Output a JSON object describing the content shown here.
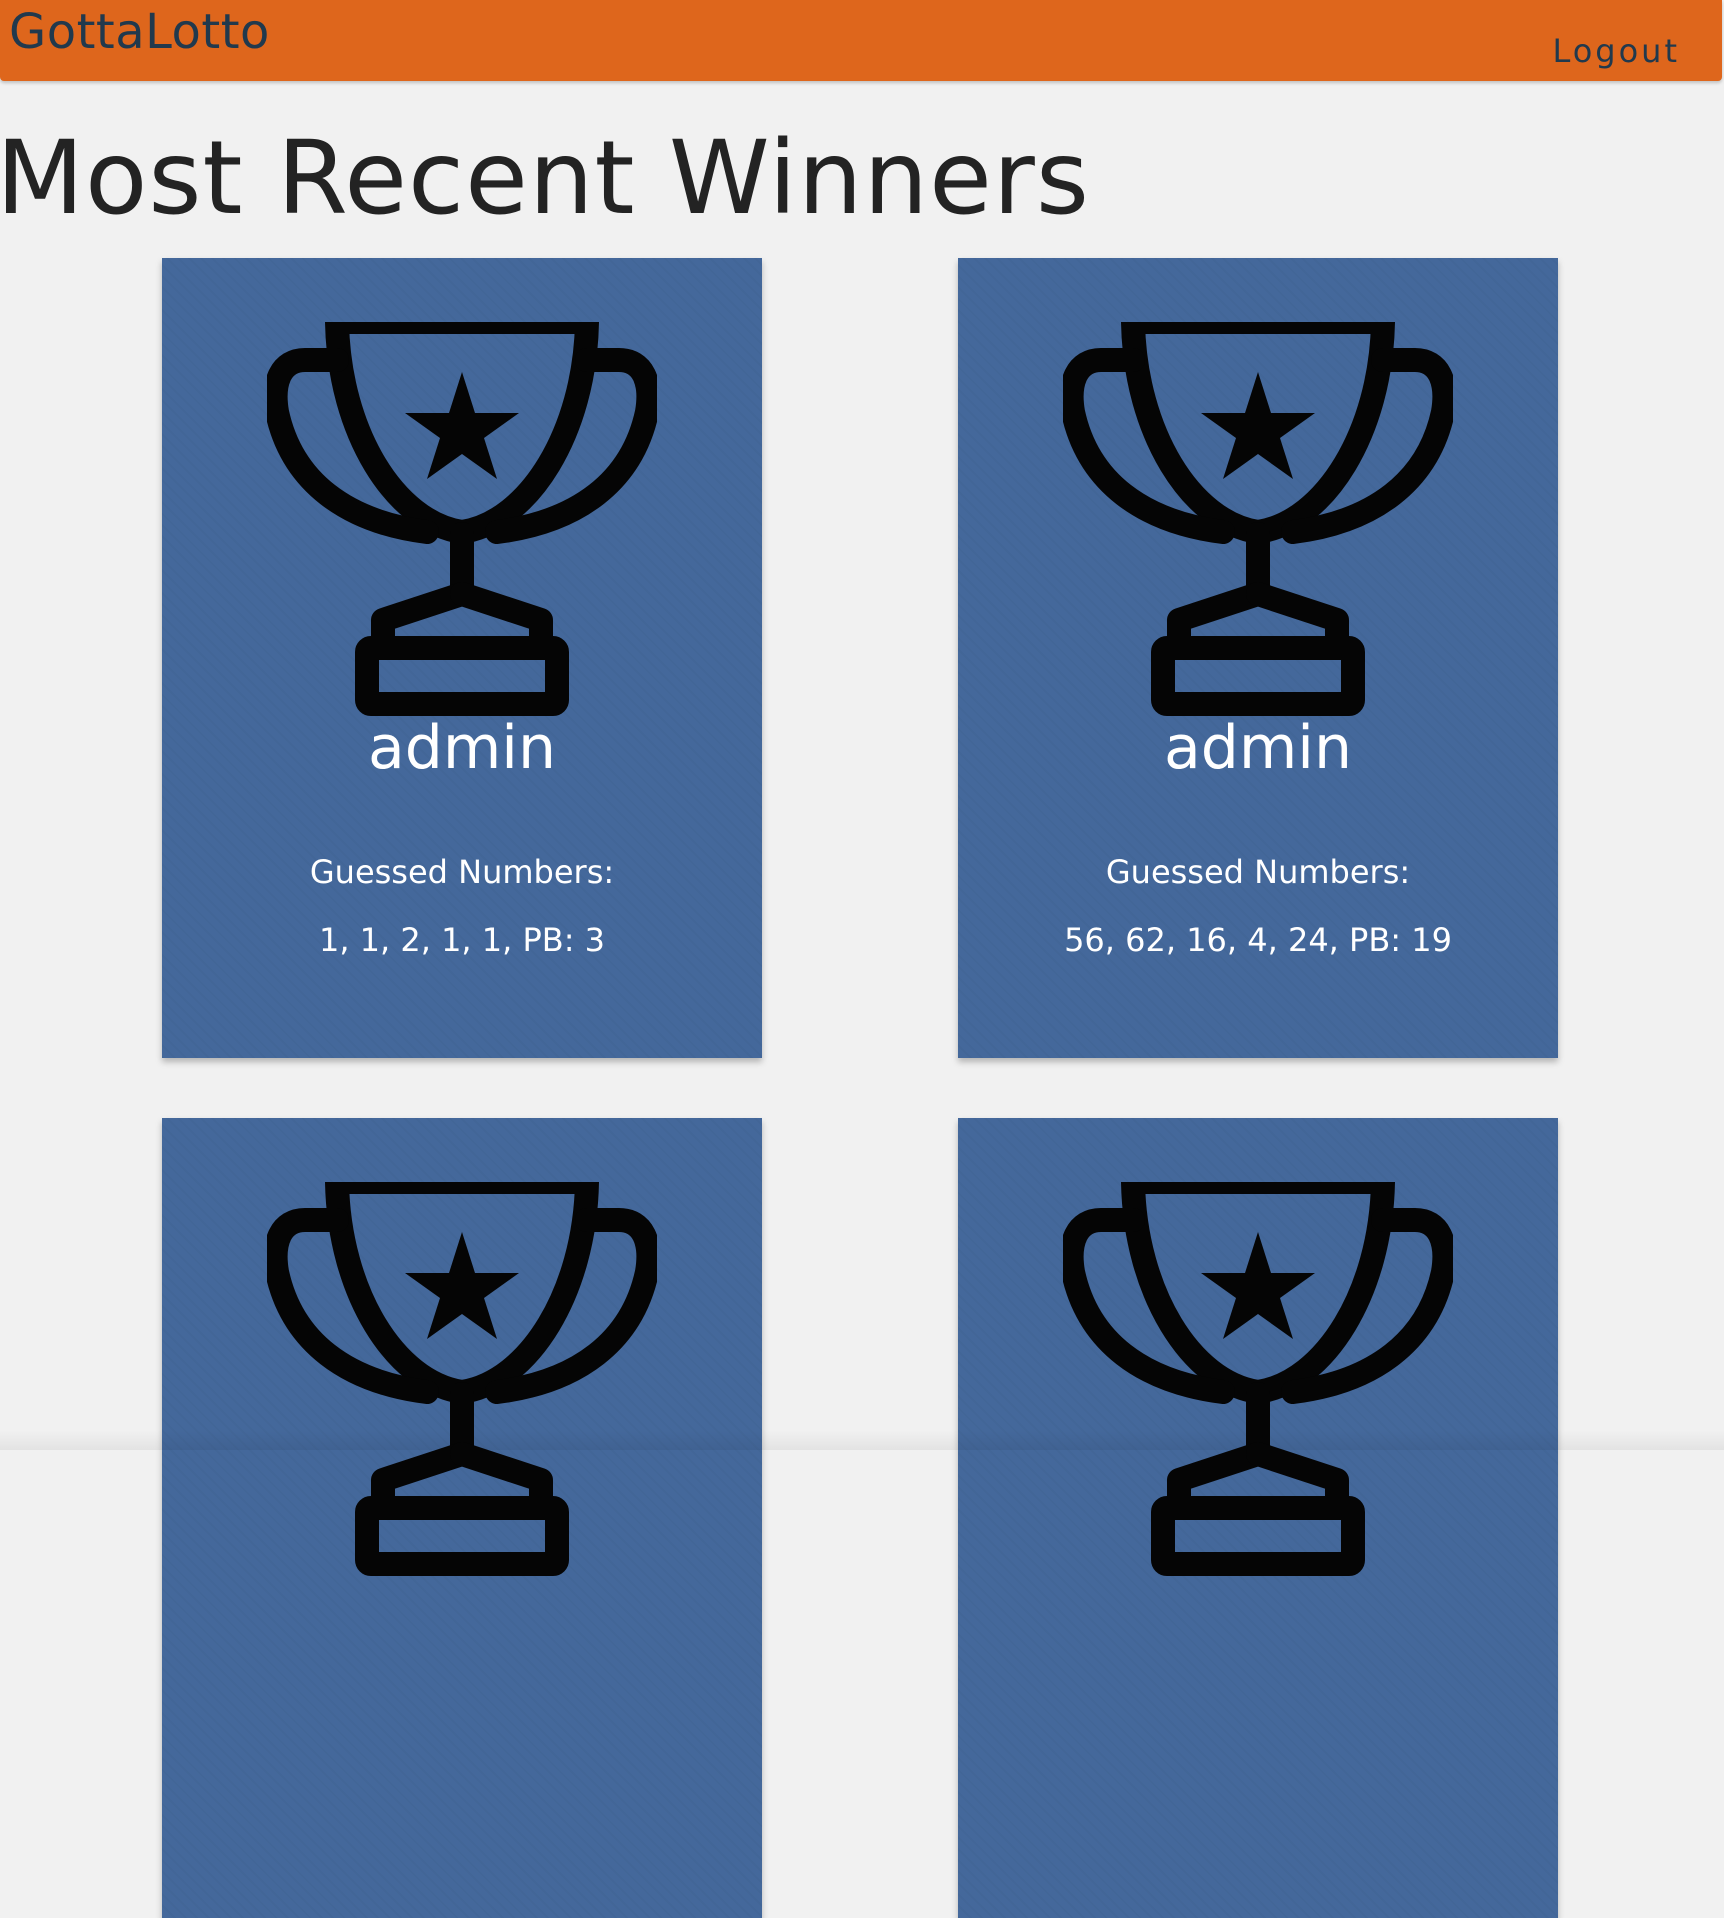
{
  "navbar": {
    "brand": "GottaLotto",
    "logout_label": "Logout"
  },
  "page": {
    "title": "Most Recent Winners"
  },
  "colors": {
    "navbar_bg": "#de661c",
    "navbar_text": "#21394d",
    "card_bg": "#44689b",
    "page_bg": "#f1f1f1"
  },
  "winners": [
    {
      "icon": "trophy-icon",
      "name": "admin",
      "guessed_label": "Guessed Numbers:",
      "numbers": "1, 1, 2, 1, 1, PB: 3"
    },
    {
      "icon": "trophy-icon",
      "name": "admin",
      "guessed_label": "Guessed Numbers:",
      "numbers": "56, 62, 16, 4, 24, PB: 19"
    },
    {
      "icon": "trophy-icon"
    },
    {
      "icon": "trophy-icon"
    }
  ]
}
